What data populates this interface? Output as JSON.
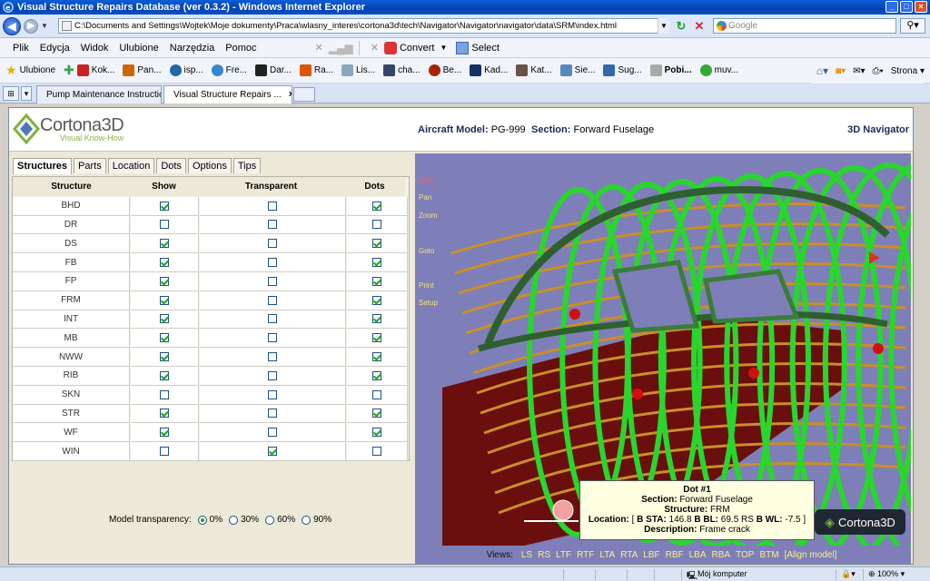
{
  "window": {
    "title": "Visual Structure Repairs Database (ver 0.3.2) - Windows Internet Explorer"
  },
  "address": {
    "url": "C:\\Documents and Settings\\Wojtek\\Moje dokumenty\\Praca\\wlasny_interes\\cortona3d\\tech\\Navigator\\Navigator\\navigator\\data\\SRM\\index.html",
    "search_placeholder": "Google"
  },
  "menu": {
    "items": [
      "Plik",
      "Edycja",
      "Widok",
      "Ulubione",
      "Narzędzia",
      "Pomoc"
    ],
    "convert": "Convert",
    "select": "Select"
  },
  "favorites": {
    "label": "Ulubione",
    "items": [
      "Kok...",
      "Pan...",
      "isp...",
      "Fre...",
      "Dar...",
      "Ra...",
      "Lis...",
      "cha...",
      "Be...",
      "Kad...",
      "Kat...",
      "Sie...",
      "Sug...",
      "Pobi...",
      "muv..."
    ],
    "strona": "Strona"
  },
  "tabs": {
    "items": [
      "Pump Maintenance Instruction",
      "Visual Structure Repairs ..."
    ]
  },
  "header": {
    "logo": "Cortona3D",
    "logo_sub": "Visual Know-How",
    "model_label": "Aircraft Model:",
    "model_value": "PG-999",
    "section_label": "Section:",
    "section_value": "Forward Fuselage",
    "nav_title": "3D Navigator"
  },
  "panel": {
    "tabs": [
      "Structures",
      "Parts",
      "Location",
      "Dots",
      "Options",
      "Tips"
    ],
    "columns": [
      "Structure",
      "Show",
      "Transparent",
      "Dots"
    ],
    "rows": [
      {
        "name": "BHD",
        "show": true,
        "transparent": false,
        "dots": true
      },
      {
        "name": "DR",
        "show": false,
        "transparent": false,
        "dots": false
      },
      {
        "name": "DS",
        "show": true,
        "transparent": false,
        "dots": true
      },
      {
        "name": "FB",
        "show": true,
        "transparent": false,
        "dots": true
      },
      {
        "name": "FP",
        "show": true,
        "transparent": false,
        "dots": true
      },
      {
        "name": "FRM",
        "show": true,
        "transparent": false,
        "dots": true
      },
      {
        "name": "INT",
        "show": true,
        "transparent": false,
        "dots": true
      },
      {
        "name": "MB",
        "show": true,
        "transparent": false,
        "dots": true
      },
      {
        "name": "NWW",
        "show": true,
        "transparent": false,
        "dots": true
      },
      {
        "name": "RIB",
        "show": true,
        "transparent": false,
        "dots": true
      },
      {
        "name": "SKN",
        "show": false,
        "transparent": false,
        "dots": false
      },
      {
        "name": "STR",
        "show": true,
        "transparent": false,
        "dots": true
      },
      {
        "name": "WF",
        "show": true,
        "transparent": false,
        "dots": true
      },
      {
        "name": "WIN",
        "show": false,
        "transparent": true,
        "dots": false
      }
    ],
    "transparency_label": "Model transparency:",
    "transparency_options": [
      "0%",
      "30%",
      "60%",
      "90%"
    ],
    "transparency_selected": "0%"
  },
  "viewer": {
    "menu": [
      "Spin",
      "Pan",
      "Zoom",
      "Goto",
      "Print",
      "Setup"
    ],
    "dot_card": {
      "title": "Dot #1",
      "section_label": "Section:",
      "section_value": "Forward Fuselage",
      "structure_label": "Structure:",
      "structure_value": "FRM",
      "location_label": "Location:",
      "location_prefix": "[",
      "sta_label": "B STA:",
      "sta_value": "146.8",
      "bl_label": "B BL:",
      "bl_value": "69.5 RS",
      "wl_label": "B WL:",
      "wl_value": "-7.5",
      "location_suffix": "]",
      "description_label": "Description:",
      "description_value": "Frame crack"
    },
    "logo": "Cortona3D",
    "views_label": "Views:",
    "views": [
      "LS",
      "RS",
      "LTF",
      "RTF",
      "LTA",
      "RTA",
      "LBF",
      "RBF",
      "LBA",
      "RBA",
      "TOP",
      "BTM",
      "[Align model]"
    ]
  },
  "status": {
    "zone": "Mój komputer",
    "zoom": "100%"
  },
  "colors": {
    "viewer_bg": "#7e7fb8",
    "frame_green": "#29d62e",
    "stringer_orange": "#c98f2a",
    "floor_red": "#6b0e0e",
    "dot_red": "#d01010"
  }
}
